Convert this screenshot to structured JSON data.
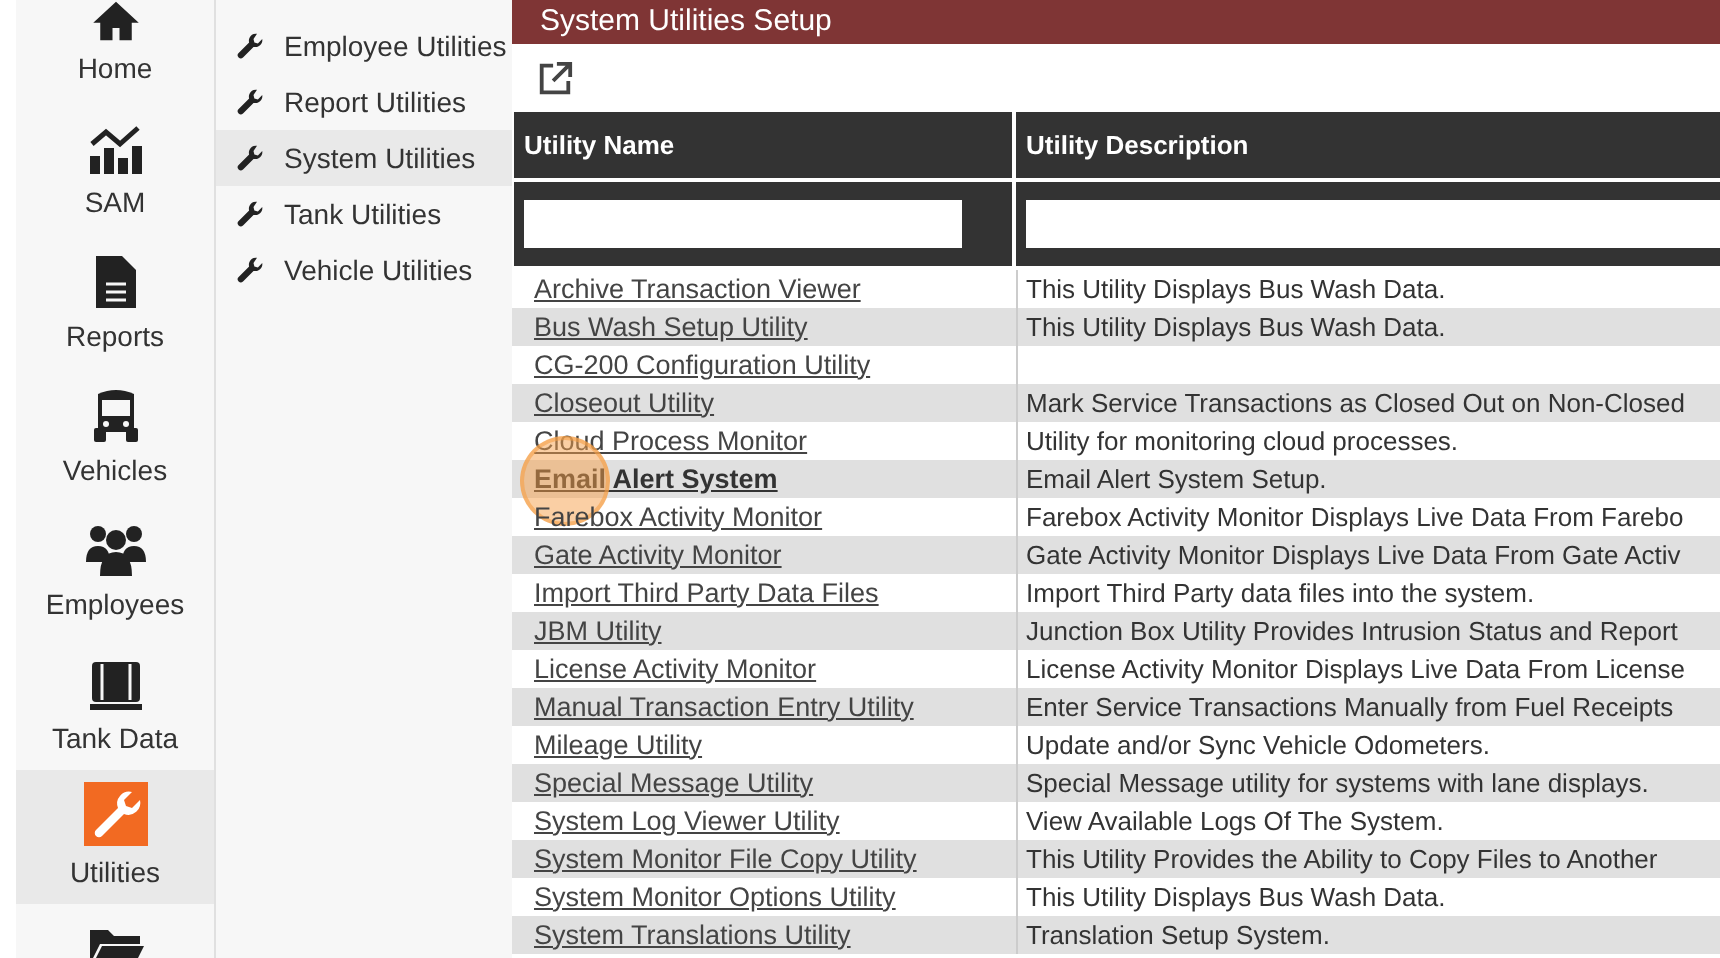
{
  "nav": [
    {
      "label": "Home",
      "selected": false
    },
    {
      "label": "SAM",
      "selected": false
    },
    {
      "label": "Reports",
      "selected": false
    },
    {
      "label": "Vehicles",
      "selected": false
    },
    {
      "label": "Employees",
      "selected": false
    },
    {
      "label": "Tank Data",
      "selected": false
    },
    {
      "label": "Utilities",
      "selected": true
    },
    {
      "selected": false
    }
  ],
  "submenu": [
    {
      "label": "Employee Utilities",
      "selected": false
    },
    {
      "label": "Report Utilities",
      "selected": false
    },
    {
      "label": "System Utilities",
      "selected": true
    },
    {
      "label": "Tank Utilities",
      "selected": false
    },
    {
      "label": "Vehicle Utilities",
      "selected": false
    }
  ],
  "panel": {
    "title": "System Utilities Setup"
  },
  "table": {
    "columns": [
      "Utility Name",
      "Utility Description"
    ],
    "rows": [
      {
        "name": "Archive Transaction Viewer",
        "description": "This Utility Displays Bus Wash Data.",
        "selected": false
      },
      {
        "name": "Bus Wash Setup Utility",
        "description": "This Utility Displays Bus Wash Data.",
        "selected": false
      },
      {
        "name": "CG-200 Configuration Utility",
        "selected": false
      },
      {
        "name": "Closeout Utility",
        "description": "Mark Service Transactions as Closed Out on Non-Closed",
        "selected": false
      },
      {
        "name": "Cloud Process Monitor",
        "description": "Utility for monitoring cloud processes.",
        "selected": false
      },
      {
        "name": "Email Alert System",
        "description": "Email Alert System Setup.",
        "selected": true
      },
      {
        "name": "Farebox Activity Monitor",
        "description": "Farebox Activity Monitor Displays Live Data From Farebo",
        "selected": false
      },
      {
        "name": "Gate Activity Monitor",
        "description": "Gate Activity Monitor Displays Live Data From Gate Activ",
        "selected": false
      },
      {
        "name": "Import Third Party Data Files",
        "description": "Import Third Party data files into the system.",
        "selected": false
      },
      {
        "name": "JBM Utility",
        "description": "Junction Box Utility Provides Intrusion Status and Report",
        "selected": false
      },
      {
        "name": "License Activity Monitor",
        "description": "License Activity Monitor Displays Live Data From License",
        "selected": false
      },
      {
        "name": "Manual Transaction Entry Utility",
        "description": "Enter Service Transactions Manually from Fuel Receipts",
        "selected": false
      },
      {
        "name": "Mileage Utility",
        "description": "Update and/or Sync Vehicle Odometers.",
        "selected": false
      },
      {
        "name": "Special Message Utility",
        "description": "Special Message utility for systems with lane displays.",
        "selected": false
      },
      {
        "name": "System Log Viewer Utility",
        "description": "View Available Logs Of The System.",
        "selected": false
      },
      {
        "name": "System Monitor File Copy Utility",
        "description": "This Utility Provides the Ability to Copy Files to Another",
        "selected": false
      },
      {
        "name": "System Monitor Options Utility",
        "description": "This Utility Displays Bus Wash Data.",
        "selected": false
      },
      {
        "name": "System Translations Utility",
        "description": "Translation Setup System.",
        "selected": false
      }
    ]
  }
}
